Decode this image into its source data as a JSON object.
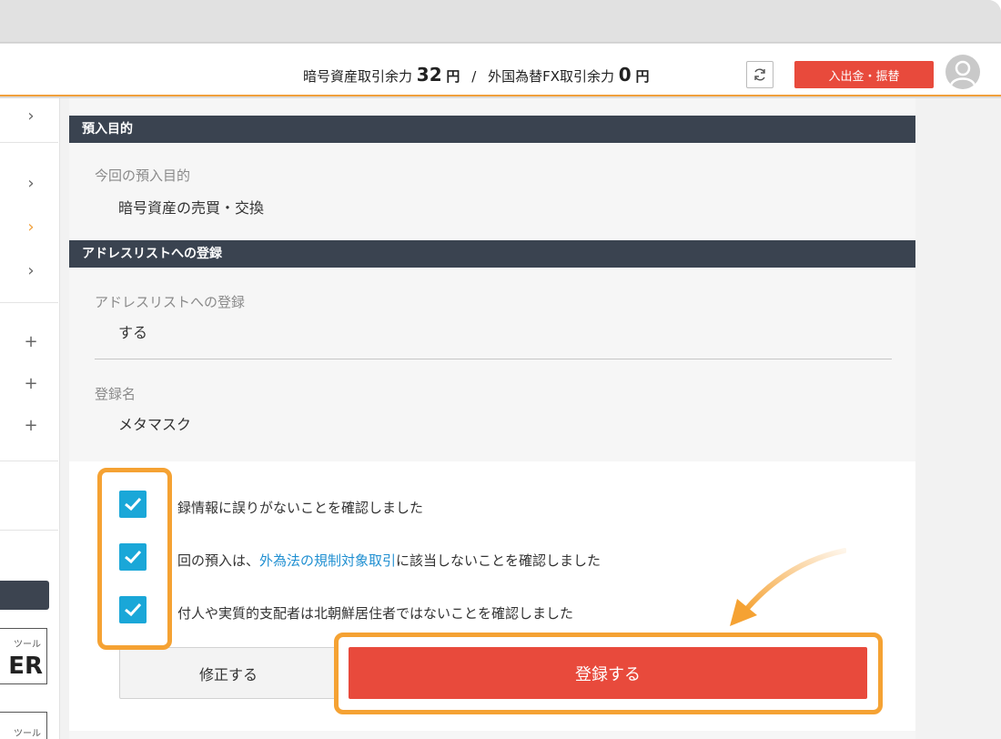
{
  "header": {
    "crypto_label": "暗号資産取引余力",
    "crypto_amount": "32",
    "crypto_unit": "円",
    "separator": "/",
    "fx_label": "外国為替FX取引余力",
    "fx_amount": "0",
    "fx_unit": "円",
    "deposit_button": "入出金・振替"
  },
  "sidebar": {
    "tool_badge_1_top": "ツール",
    "tool_badge_1_text": "ER",
    "tool_badge_2_top": "ツール"
  },
  "sections": {
    "purpose_header": "預入目的",
    "purpose_label": "今回の預入目的",
    "purpose_value": "暗号資産の売買・交換",
    "address_header": "アドレスリストへの登録",
    "address_label": "アドレスリストへの登録",
    "address_value": "する",
    "name_label": "登録名",
    "name_value": "メタマスク"
  },
  "checks": {
    "check1": "録情報に誤りがないことを確認しました",
    "check2_pre": "回の預入は、",
    "check2_link": "外為法の規制対象取引",
    "check2_post": "に該当しないことを確認しました",
    "check3": "付人や実質的支配者は北朝鮮居住者ではないことを確認しました"
  },
  "buttons": {
    "fix": "修正する",
    "register": "登録する"
  },
  "colors": {
    "accent_red": "#e84a3c",
    "highlight_orange": "#f5a233",
    "checkbox_blue": "#1aa7d8",
    "section_header": "#3a4350",
    "link_blue": "#1f8fd1"
  }
}
